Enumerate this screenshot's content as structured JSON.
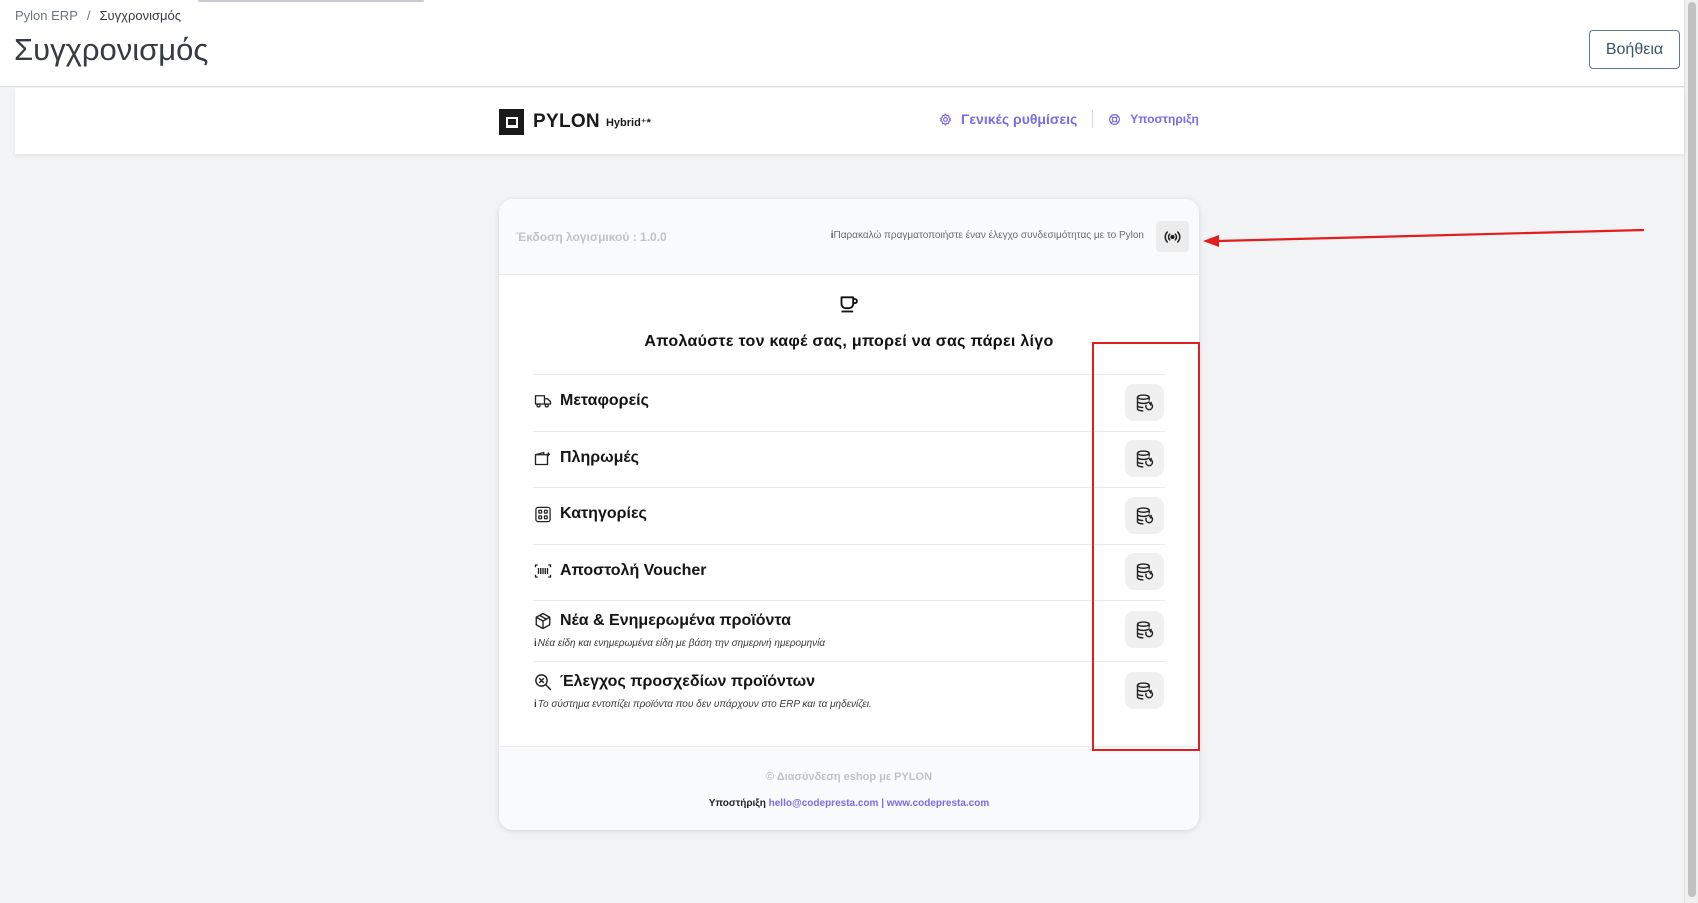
{
  "breadcrumb": {
    "root": "Pylon ERP",
    "separator": "/",
    "current": "Συγχρονισμός"
  },
  "page": {
    "title": "Συγχρονισμός",
    "help_label": "Βοήθεια"
  },
  "module_bar": {
    "logo_text": "PYLON",
    "logo_sub": "Hybrid⁺*",
    "nav": [
      {
        "label": "Γενικές ρυθμίσεις",
        "icon": "gear-icon"
      },
      {
        "label": "Υποστηριξη",
        "icon": "lifebuoy-icon"
      }
    ]
  },
  "card": {
    "version": "Έκδοση λογισμικού : 1.0.0",
    "connectivity_icon": "i",
    "connectivity_note": "Παρακαλώ πραγματοποιήστε έναν έλεγχο συνδεσιμότητας με το Pylon",
    "heading": "Απολαύστε τον καφέ σας, μπορεί να σας πάρει λίγο",
    "sync_items": [
      {
        "title": "Μεταφορείς",
        "icon": "truck-icon",
        "note": ""
      },
      {
        "title": "Πληρωμές",
        "icon": "wallet-icon",
        "note": ""
      },
      {
        "title": "Κατηγορίες",
        "icon": "grid-icon",
        "note": ""
      },
      {
        "title": "Αποστολή Voucher",
        "icon": "barcode-icon",
        "note": ""
      },
      {
        "title": "Νέα & Ενημερωμένα προϊόντα",
        "icon": "box-icon",
        "note": "Νέα είδη και ενημερωμένα είδη με βάση την σημερινή ημερομηνία"
      },
      {
        "title": "Έλεγχος προσχεδίων προϊόντων",
        "icon": "search-x-icon",
        "note": "Το σύστημα εντοπίζει προϊόντα που δεν υπάρχουν στο ERP και τα μηδενίζει."
      }
    ],
    "footer": {
      "credit": "© Διασύνδεση eshop με PYLON",
      "support_label": "Υποστήριξη",
      "email": "hello@codepresta.com",
      "divider": "|",
      "website": "www.codepresta.com"
    }
  },
  "colors": {
    "accent": "#7a6be6",
    "annotation": "#e21d1d"
  }
}
